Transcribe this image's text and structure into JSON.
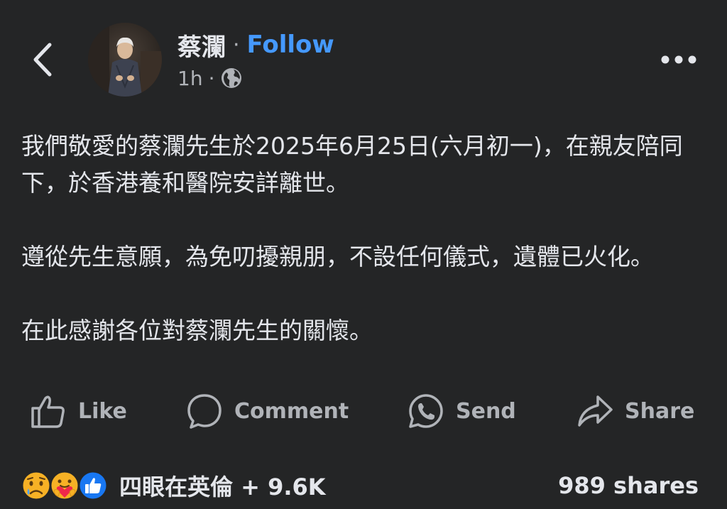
{
  "header": {
    "author_name": "蔡瀾",
    "separator": "·",
    "follow_label": "Follow",
    "time": "1h",
    "meta_separator": "·",
    "audience_icon": "globe-icon",
    "back_icon": "chevron-left-icon",
    "more_icon": "more-horizontal-icon"
  },
  "post": {
    "paragraphs": [
      "我們敬愛的蔡瀾先生於2025年6月25日(六月初一)，在親友陪同下，於香港養和醫院安詳離世。",
      "遵從先生意願，為免叨擾親朋，不設任何儀式，遺體已火化。",
      "在此感謝各位對蔡瀾先生的關懷。"
    ]
  },
  "actions": {
    "like_label": "Like",
    "comment_label": "Comment",
    "send_label": "Send",
    "share_label": "Share"
  },
  "footer": {
    "reaction_icons": [
      "sad-reaction-icon",
      "care-reaction-icon",
      "like-reaction-icon"
    ],
    "reaction_summary": "四眼在英倫 + 9.6K",
    "shares": "989 shares"
  },
  "colors": {
    "background": "#242526",
    "text": "#e4e6eb",
    "secondary_text": "#b0b3b8",
    "follow_blue": "#4599ff",
    "like_blue": "#1877f2",
    "sad_yellow": "#f7b125",
    "care_red": "#f0284a"
  }
}
